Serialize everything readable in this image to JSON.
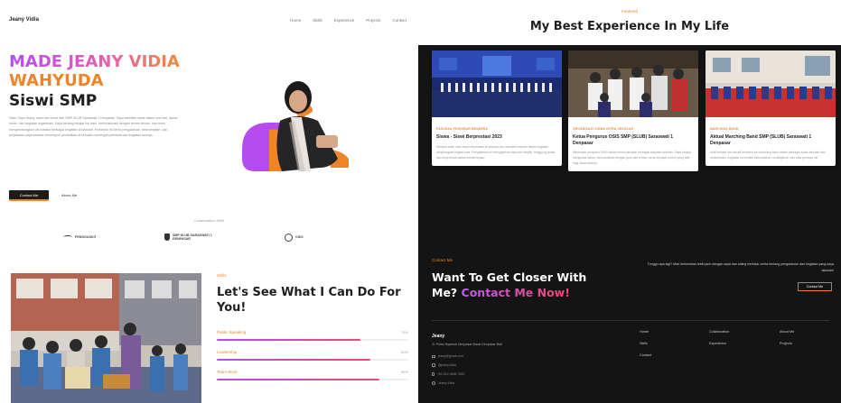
{
  "nav": {
    "brand": "Jeany Vidia",
    "links": [
      "Home",
      "Skills",
      "Experience",
      "Projects",
      "Contact"
    ]
  },
  "hero": {
    "name_line1": "MADE JEANY VIDIA",
    "name_line2": "WAHYUDA",
    "role": "Siswi SMP",
    "paragraph": "Halo! Saya Jeany, siswi dari Ubud dan SMP SLUB Saraswati 1 Denpasar. Saya memiliki minat dalam seni tari, dance cover, dan kegiatan organisasi. Saya senang belajar hal baru, berkolaborasi dengan teman-teman, dan terus mengembangkan diri melalui berbagai kegiatan di sekolah. Portofolio ini berisi pengalaman, keterampilan, dan perjalanan saya selama menempuh pendidikan di sekolah menengah pertama dan kegiatan lainnya.",
    "contact_button": "Contact Me",
    "about_link": "About Me"
  },
  "collab": {
    "title": "Collaboration With",
    "logos": [
      "PENGGASKIT",
      "SMP SLUB SARASWATI 1 DENPASAR",
      "OSIS"
    ]
  },
  "skills": {
    "tag": "Skills",
    "title": "Let's See What I Can Do For You!",
    "items": [
      {
        "label": "Public Speaking",
        "pct_text": "75%",
        "level": 0.75
      },
      {
        "label": "Leadership",
        "pct_text": "80%",
        "level": 0.8
      },
      {
        "label": "Team Work",
        "pct_text": "85%",
        "level": 0.85
      }
    ]
  },
  "experience": {
    "tag": "Featured",
    "title": "My Best Experience In My Life",
    "cards": [
      {
        "tag": "PASUKAN PENGIBAR BENDERA",
        "title": "Siswa - Siswi Berprestasi 2023",
        "desc": "Menjadi salah satu siswi berprestasi di sekolah dan mewakili sekolah dalam kegiatan penghargaan tingkat kota. Pengalaman ini mengajarkan saya arti disiplin, tanggung jawab, dan kerja keras dalam meraih tujuan."
      },
      {
        "tag": "ORGANISASI SISWA INTRA SEKOLAH",
        "title": "Ketua Pengurus OSIS SMP (SLUB) Saraswati 1 Denpasar",
        "desc": "Memimpin pengurus OSIS dalam merencanakan berbagai kegiatan sekolah. Saya belajar mengelola waktu, berkoordinasi dengan guru dan teman, serta menjadi contoh yang baik bagi siswa lainnya."
      },
      {
        "tag": "MARCHING BAND",
        "title": "Aktual Marching Band SMP (SLUB) Saraswati 1 Denpasar",
        "desc": "Aktif berlatih dan tampil bersama tim marching band dalam berbagai acara sekolah dan perlombaan. Kegiatan ini melatih kekompakan, kedisiplinan, dan rasa percaya diri."
      }
    ]
  },
  "cta": {
    "tag": "Contact Me",
    "title_line1": "Want To Get Closer With",
    "title_line2_plain": "Me? ",
    "title_line2_highlight": "Contact Me Now!",
    "text": "Tunggu apa lagi? Mari berkenalan lebih jauh dengan saya dan saling bertukar cerita tentang pengalaman dan kegiatan yang saya lakukan!",
    "button": "Contact Me"
  },
  "footer": {
    "name": "Jeany",
    "address": "Jl. Pulau Nyamuk Denpasar Barat Denpasar Bali",
    "info": [
      "jeany@gmail.com",
      "@jeany.vidia",
      "+62 812 3456 7890",
      "Jeany Vidia"
    ],
    "col1": [
      "Home",
      "Skills",
      "Contact"
    ],
    "col2": [
      "Collaboration",
      "Experience"
    ],
    "col3": [
      "About Me",
      "Projects"
    ]
  },
  "colors": {
    "accent_orange": "#f08428",
    "accent_purple": "#b44cf0",
    "accent_pink": "#f0476c",
    "dark_bg": "#141414"
  }
}
